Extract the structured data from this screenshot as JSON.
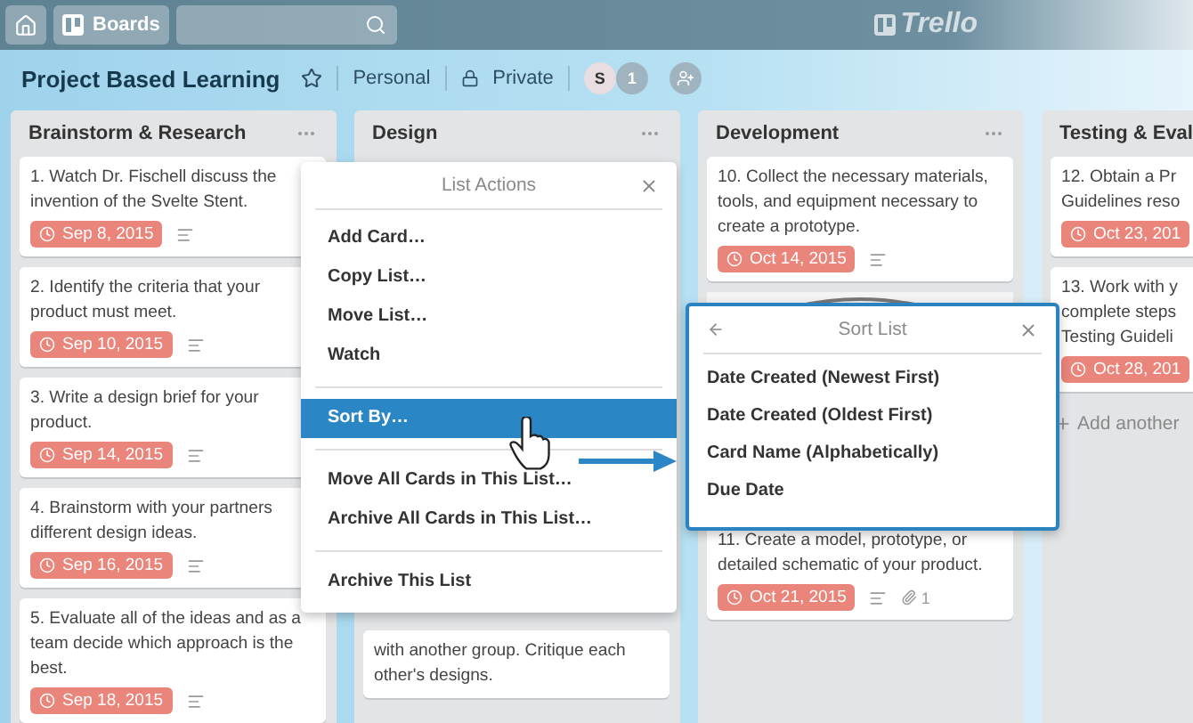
{
  "topbar": {
    "boards_label": "Boards",
    "logo": "Trello"
  },
  "board": {
    "title": "Project Based Learning",
    "personal_label": "Personal",
    "private_label": "Private",
    "member_initial": "S",
    "member_count": "1"
  },
  "lists": [
    {
      "title": "Brainstorm & Research",
      "cards": [
        {
          "lines": [
            "1. Watch Dr. Fischell discuss the",
            "invention of the Svelte Stent."
          ],
          "due": "Sep 8, 2015",
          "description": true
        },
        {
          "lines": [
            "2. Identify the criteria that your",
            "product must meet."
          ],
          "due": "Sep 10, 2015",
          "description": true
        },
        {
          "lines": [
            "3. Write a design brief for your",
            "product."
          ],
          "due": "Sep 14, 2015",
          "description": true
        },
        {
          "lines": [
            "4. Brainstorm with your partners",
            "different design ideas."
          ],
          "due": "Sep 16, 2015",
          "description": true
        },
        {
          "lines": [
            "5. Evaluate all of the ideas and as a",
            "team decide which approach is the",
            "best."
          ],
          "due": "Sep 18, 2015",
          "description": true
        }
      ]
    },
    {
      "title": "Design",
      "cards": [
        {
          "lines": [
            "with another group. Critique each",
            "other's designs."
          ]
        }
      ]
    },
    {
      "title": "Development",
      "cards": [
        {
          "lines": [
            "10. Collect the necessary materials,",
            "tools, and equipment necessary to",
            "create a prototype."
          ],
          "due": "Oct 14, 2015",
          "description": true
        },
        {
          "cover": true,
          "lines": [
            "11. Create a model, prototype, or",
            "detailed schematic of your product."
          ],
          "due": "Oct 21, 2015",
          "description": true,
          "attachments": "1"
        }
      ]
    },
    {
      "title": "Testing & Eval",
      "cards": [
        {
          "lines": [
            "12. Obtain a Pr",
            "Guidelines reso"
          ],
          "due": "Oct 23, 201"
        },
        {
          "lines": [
            "13. Work with y",
            "complete steps",
            "Testing Guideli"
          ],
          "due": "Oct 28, 201"
        }
      ],
      "add_label": "Add another"
    }
  ],
  "list_actions": {
    "title": "List Actions",
    "groups": [
      [
        {
          "label": "Add Card…",
          "selected": false
        },
        {
          "label": "Copy List…",
          "selected": false
        },
        {
          "label": "Move List…",
          "selected": false
        },
        {
          "label": "Watch",
          "selected": false
        }
      ],
      [
        {
          "label": "Sort By…",
          "selected": true
        }
      ],
      [
        {
          "label": "Move All Cards in This List…",
          "selected": false
        },
        {
          "label": "Archive All Cards in This List…",
          "selected": false
        }
      ],
      [
        {
          "label": "Archive This List",
          "selected": false
        }
      ]
    ]
  },
  "sort_list": {
    "title": "Sort List",
    "options": [
      "Date Created (Newest First)",
      "Date Created (Oldest First)",
      "Card Name (Alphabetically)",
      "Due Date"
    ]
  }
}
